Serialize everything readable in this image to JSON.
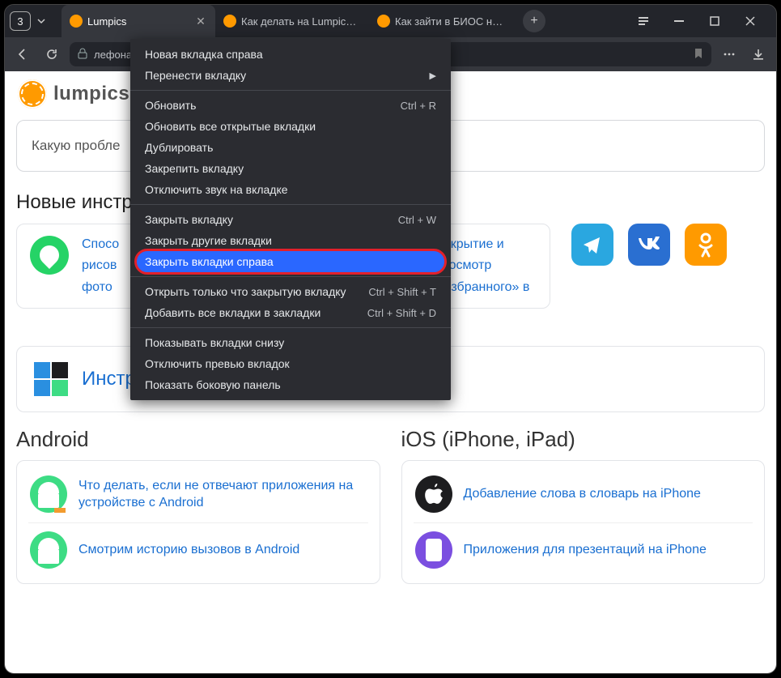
{
  "window": {
    "tabCount": "3",
    "tabs": [
      {
        "title": "Lumpics",
        "faviconColor": "#ff9a00",
        "active": true,
        "closable": true
      },
      {
        "title": "Как делать на Lumpics D",
        "faviconColor": "#ff9a00",
        "active": false,
        "closable": false
      },
      {
        "title": "Как зайти в БИОС на н",
        "faviconColor": "#ff9a00",
        "active": false,
        "closable": false
      }
    ]
  },
  "nav": {
    "urlText": "лефонами и интернет-серви..."
  },
  "contextMenu": {
    "groups": [
      [
        {
          "id": "new-tab-right",
          "label": "Новая вкладка справа",
          "shortcut": "",
          "submenu": false
        },
        {
          "id": "move-tab",
          "label": "Перенести вкладку",
          "shortcut": "",
          "submenu": true
        }
      ],
      [
        {
          "id": "reload",
          "label": "Обновить",
          "shortcut": "Ctrl + R"
        },
        {
          "id": "reload-all",
          "label": "Обновить все открытые вкладки",
          "shortcut": ""
        },
        {
          "id": "duplicate",
          "label": "Дублировать",
          "shortcut": ""
        },
        {
          "id": "pin",
          "label": "Закрепить вкладку",
          "shortcut": ""
        },
        {
          "id": "mute",
          "label": "Отключить звук на вкладке",
          "shortcut": ""
        }
      ],
      [
        {
          "id": "close",
          "label": "Закрыть вкладку",
          "shortcut": "Ctrl + W"
        },
        {
          "id": "close-other",
          "label": "Закрыть другие вкладки",
          "shortcut": ""
        },
        {
          "id": "close-right",
          "label": "Закрыть вкладки справа",
          "shortcut": "",
          "highlight": true
        }
      ],
      [
        {
          "id": "reopen-closed",
          "label": "Открыть только что закрытую вкладку",
          "shortcut": "Ctrl + Shift + T"
        },
        {
          "id": "bookmark-all",
          "label": "Добавить все вкладки в закладки",
          "shortcut": "Ctrl + Shift + D"
        }
      ],
      [
        {
          "id": "tabs-below",
          "label": "Показывать вкладки снизу",
          "shortcut": ""
        },
        {
          "id": "disable-preview",
          "label": "Отключить превью вкладок",
          "shortcut": ""
        },
        {
          "id": "sidebar",
          "label": "Показать боковую панель",
          "shortcut": ""
        }
      ]
    ]
  },
  "page": {
    "logoText": "lumpics.",
    "searchPlaceholder": "Какую пробле",
    "newInstrTitle": "Новые инстр",
    "card1": {
      "l1": "Спосо",
      "l2": "рисов",
      "l3": "фото"
    },
    "card2": {
      "l1": "Открытие и",
      "l2": "просмотр",
      "l3": "«Избранного» в"
    },
    "osBannerTitle": "Инструкции по операционным системам",
    "androidTitle": "Android",
    "iosTitle": "iOS (iPhone, iPad)",
    "androidItems": [
      {
        "text": "Что делать, если не отвечают приложения на устройстве с Android"
      },
      {
        "text": "Смотрим историю вызовов в Android"
      }
    ],
    "iosItems": [
      {
        "text": "Добавление слова в словарь на iPhone"
      },
      {
        "text": "Приложения для презентаций на iPhone"
      }
    ]
  }
}
